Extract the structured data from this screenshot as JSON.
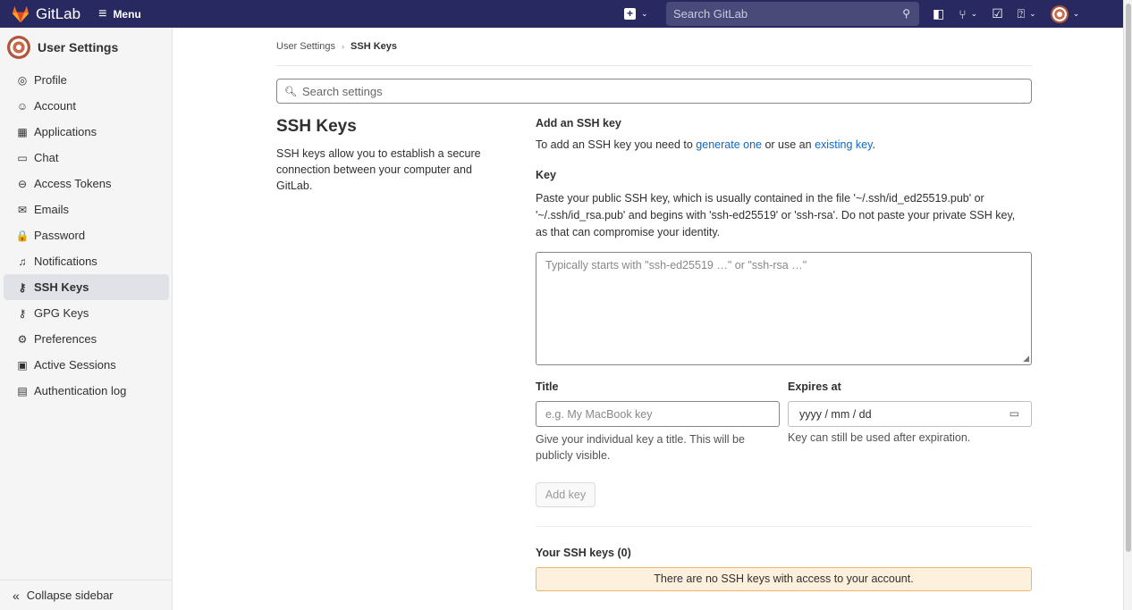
{
  "navbar": {
    "brand": "GitLab",
    "menu_label": "Menu",
    "new_icon": "plus-square-icon",
    "search_placeholder": "Search GitLab"
  },
  "sidebar": {
    "title": "User Settings",
    "items": [
      {
        "label": "Profile",
        "icon": "profile-icon",
        "glyph": "◎"
      },
      {
        "label": "Account",
        "icon": "account-icon",
        "glyph": "☺"
      },
      {
        "label": "Applications",
        "icon": "applications-icon",
        "glyph": "▦"
      },
      {
        "label": "Chat",
        "icon": "chat-icon",
        "glyph": "▭"
      },
      {
        "label": "Access Tokens",
        "icon": "token-icon",
        "glyph": "⊖"
      },
      {
        "label": "Emails",
        "icon": "mail-icon",
        "glyph": "✉"
      },
      {
        "label": "Password",
        "icon": "lock-icon",
        "glyph": "🔒"
      },
      {
        "label": "Notifications",
        "icon": "bell-icon",
        "glyph": "♫"
      },
      {
        "label": "SSH Keys",
        "icon": "key-icon",
        "glyph": "⚷",
        "active": true
      },
      {
        "label": "GPG Keys",
        "icon": "key-icon",
        "glyph": "⚷"
      },
      {
        "label": "Preferences",
        "icon": "preferences-icon",
        "glyph": "⚙"
      },
      {
        "label": "Active Sessions",
        "icon": "monitor-icon",
        "glyph": "▣"
      },
      {
        "label": "Authentication log",
        "icon": "log-icon",
        "glyph": "▤"
      }
    ],
    "collapse_label": "Collapse sidebar"
  },
  "breadcrumb": {
    "parent": "User Settings",
    "current": "SSH Keys"
  },
  "search_settings": {
    "placeholder": "Search settings"
  },
  "section": {
    "title": "SSH Keys",
    "description": "SSH keys allow you to establish a secure connection between your computer and GitLab."
  },
  "form": {
    "heading": "Add an SSH key",
    "intro_prefix": "To add an SSH key you need to ",
    "intro_link1": "generate one",
    "intro_mid": " or use an ",
    "intro_link2": "existing key",
    "intro_suffix": ".",
    "key_label": "Key",
    "key_help": "Paste your public SSH key, which is usually contained in the file '~/.ssh/id_ed25519.pub' or '~/.ssh/id_rsa.pub' and begins with 'ssh-ed25519' or 'ssh-rsa'. Do not paste your private SSH key, as that can compromise your identity.",
    "key_placeholder": "Typically starts with \"ssh-ed25519 …\" or \"ssh-rsa …\"",
    "title_label": "Title",
    "title_placeholder": "e.g. My MacBook key",
    "title_help": "Give your individual key a title. This will be publicly visible.",
    "expires_label": "Expires at",
    "expires_placeholder": "yyyy / mm / dd",
    "expires_help": "Key can still be used after expiration.",
    "submit_label": "Add key"
  },
  "keys_list": {
    "heading": "Your SSH keys (0)",
    "empty_message": "There are no SSH keys with access to your account."
  },
  "colors": {
    "navbar": "#292961",
    "link": "#1068bf",
    "alert_bg": "#fdf1dd",
    "alert_border": "#e9b66c"
  }
}
